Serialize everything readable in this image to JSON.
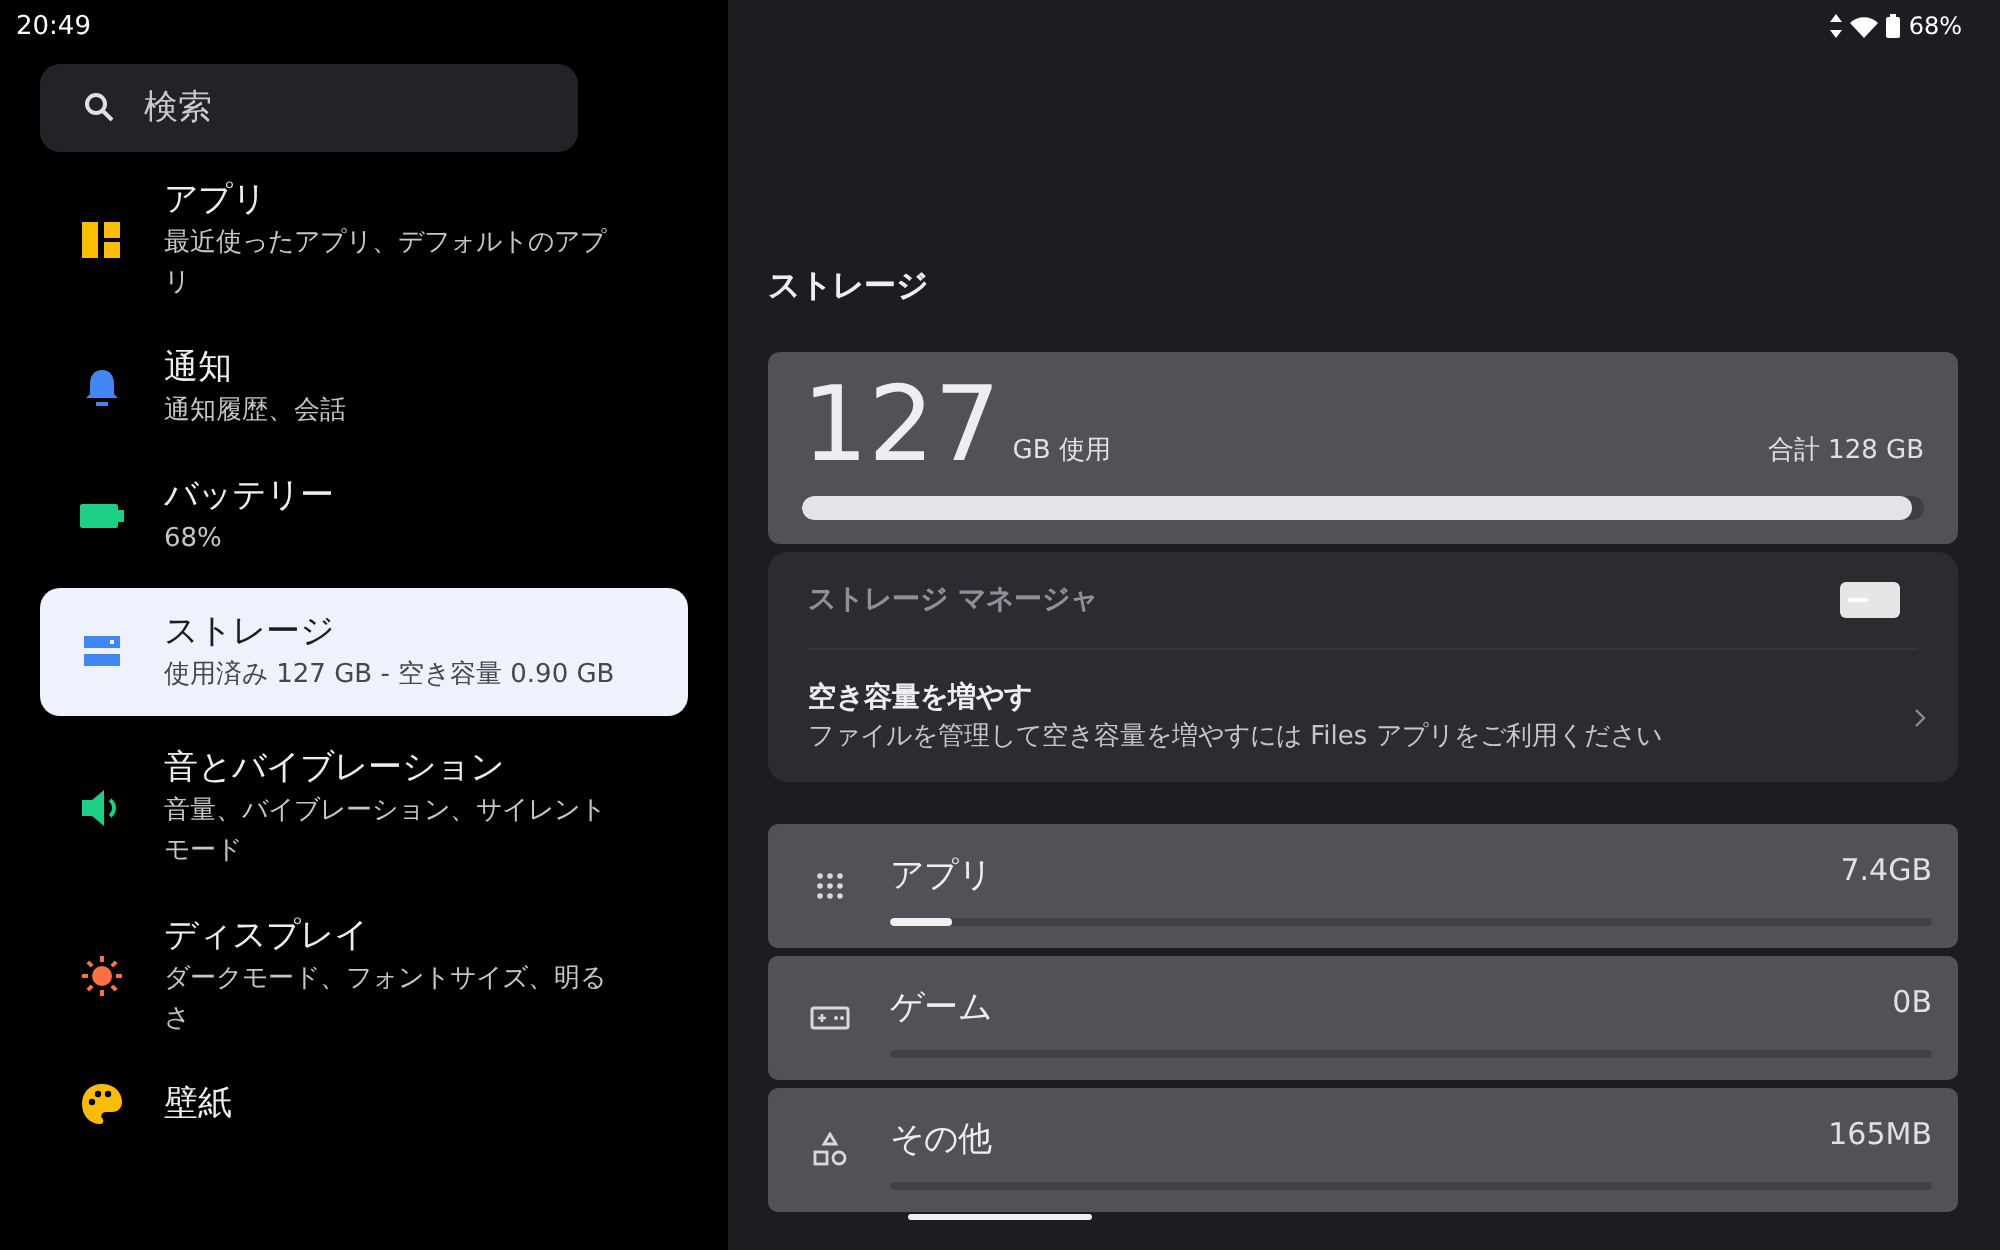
{
  "status_bar": {
    "time": "20:49",
    "battery": "68%"
  },
  "search": {
    "placeholder": "検索"
  },
  "sidebar": {
    "items": [
      {
        "title": "アプリ",
        "subtitle": "最近使ったアプリ、デフォルトのアプリ",
        "selected": false
      },
      {
        "title": "通知",
        "subtitle": "通知履歴、会話",
        "selected": false
      },
      {
        "title": "バッテリー",
        "subtitle": "68%",
        "selected": false
      },
      {
        "title": "ストレージ",
        "subtitle": "使用済み 127 GB - 空き容量 0.90 GB",
        "selected": true
      },
      {
        "title": "音とバイブレーション",
        "subtitle": "音量、バイブレーション、サイレントモード",
        "selected": false
      },
      {
        "title": "ディスプレイ",
        "subtitle": "ダークモード、フォントサイズ、明るさ",
        "selected": false
      },
      {
        "title": "壁紙",
        "selected": false
      }
    ]
  },
  "page_title": "ストレージ",
  "summary": {
    "used": "127",
    "used_unit": "GB 使用",
    "total": "合計 128 GB",
    "level": 0.99
  },
  "manager": {
    "label": "ストレージ マネージャ",
    "on": false
  },
  "free_up": {
    "title": "空き容量を増やす",
    "subtitle": "ファイルを管理して空き容量を増やすには Files アプリをご利用ください"
  },
  "categories": [
    {
      "name": "アプリ",
      "size": "7.4GB",
      "level": 0.06
    },
    {
      "name": "ゲーム",
      "size": "0B",
      "level": 0
    },
    {
      "name": "その他",
      "size": "165MB",
      "level": 0
    }
  ]
}
